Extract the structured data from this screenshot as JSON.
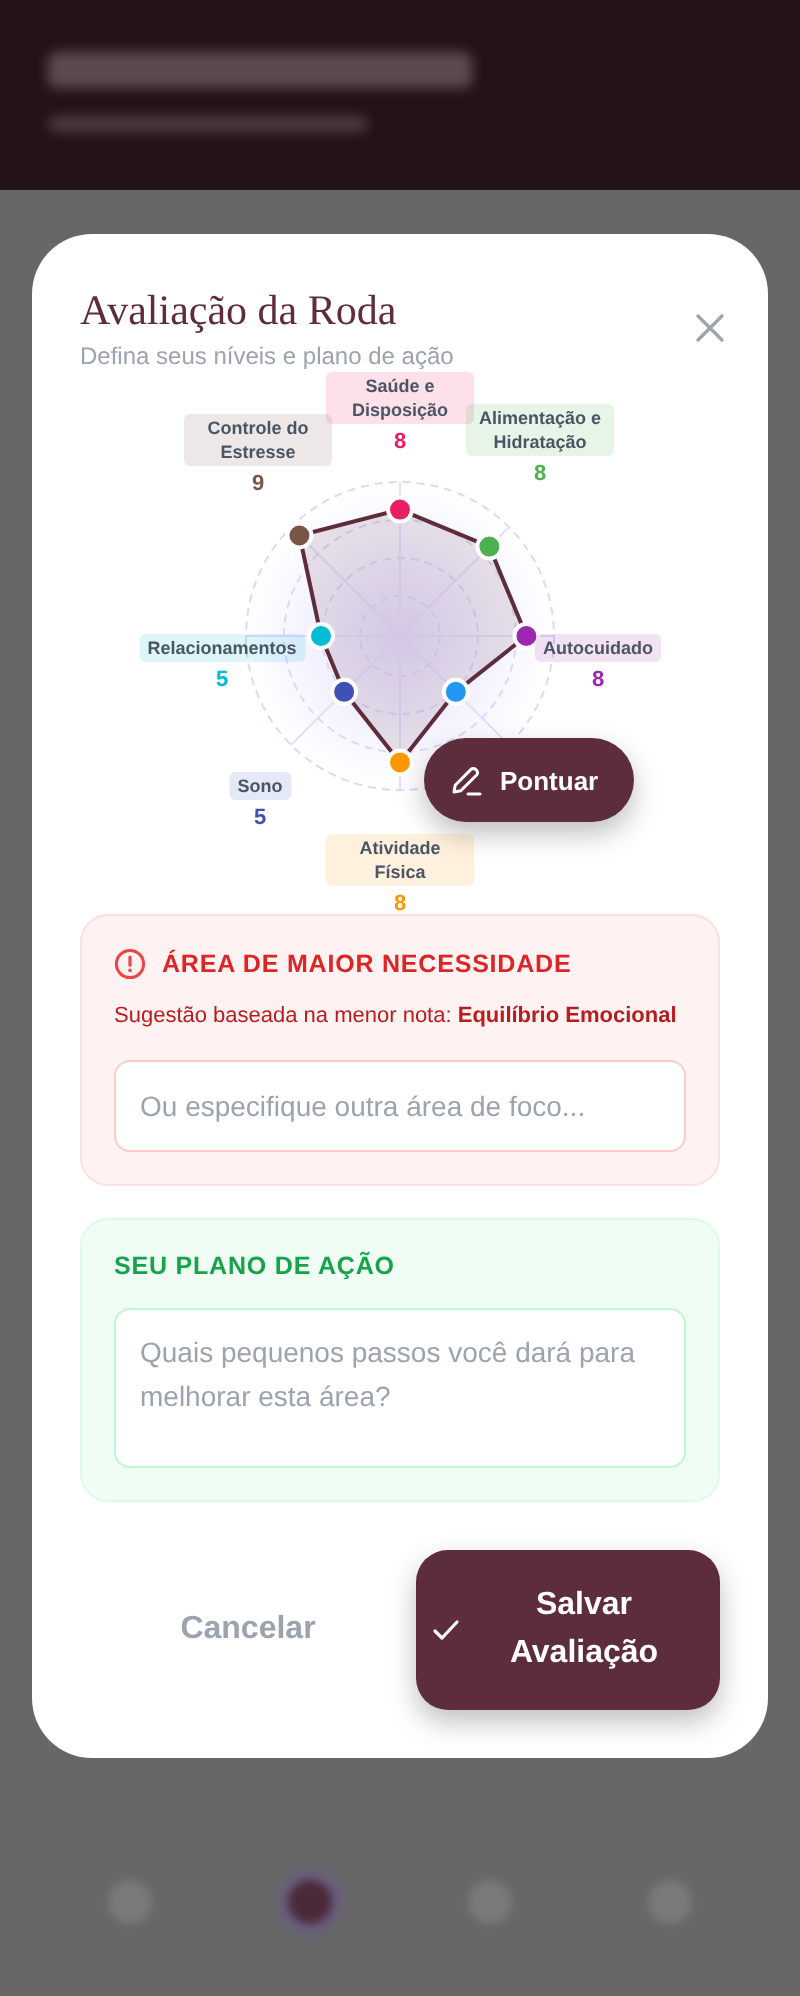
{
  "modal": {
    "title": "Avaliação da Roda",
    "subtitle": "Defina seus níveis e plano de ação"
  },
  "wheel": {
    "areas": [
      {
        "label": "Saúde e Disposição",
        "score": "8",
        "color": "#e91e63"
      },
      {
        "label": "Controle do Estresse",
        "score": "9",
        "color": "#795548"
      },
      {
        "label": "Alimentação e Hidratação",
        "score": "8",
        "color": "#4caf50"
      },
      {
        "label": "Relacionamentos",
        "score": "5",
        "color": "#00bcd4"
      },
      {
        "label": "Autocuidado",
        "score": "8",
        "color": "#9c27b0"
      },
      {
        "color": "#2196f3"
      },
      {
        "label": "Sono",
        "score": "5",
        "color": "#3f51b5"
      },
      {
        "label": "Atividade Física",
        "score": "8",
        "color": "#ff9800"
      }
    ],
    "action": "Pontuar"
  },
  "need_card": {
    "heading": "ÁREA DE MAIOR NECESSIDADE",
    "suggestion": "Sugestão baseada na menor nota: **Equilíbrio Emocional**",
    "placeholder": "Ou especifique outra área de foco..."
  },
  "plan_card": {
    "heading": "SEU PLANO DE AÇÃO",
    "placeholder": "Quais pequenos passos você dará para melhorar esta área?"
  },
  "buttons": {
    "cancel": "Cancelar",
    "save": "Salvar Avaliação"
  },
  "nav": [
    {
      "selected": false
    },
    {
      "selected": true
    },
    {
      "selected": false
    },
    {
      "selected": false
    }
  ]
}
